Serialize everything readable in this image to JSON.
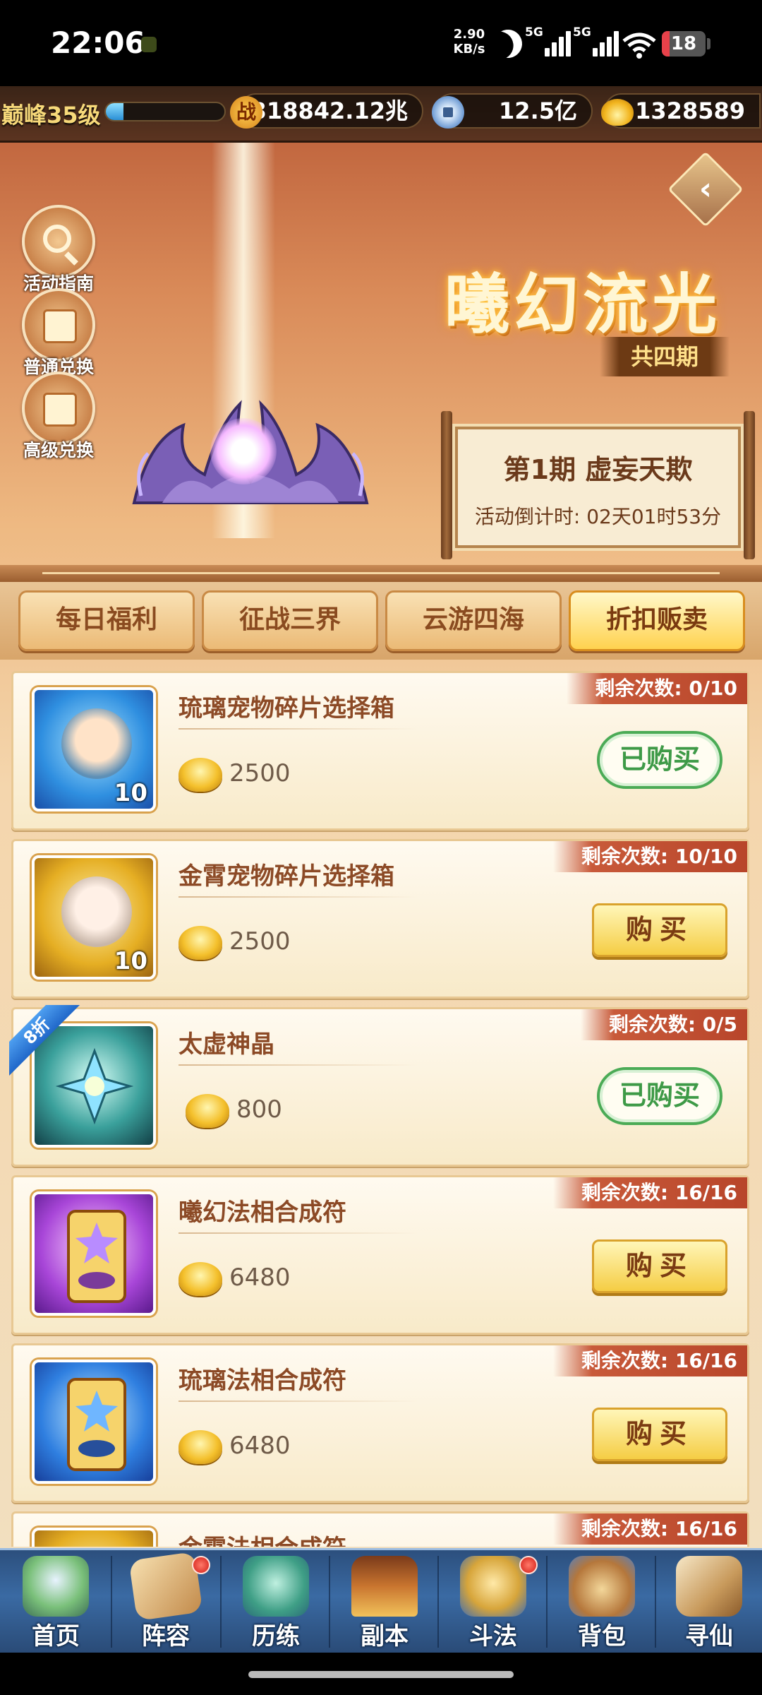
{
  "status": {
    "time": "22:06",
    "speed_value": "2.90",
    "speed_unit": "KB/s",
    "net1": "5G",
    "net2": "5G",
    "battery": "18",
    "battery_level": 0.18
  },
  "hud": {
    "level": "巅峰35级",
    "level_progress": 0.15,
    "power_icon": "战",
    "power": "318842.12兆",
    "coins": "12.5亿",
    "ingots": "1328589"
  },
  "side_buttons": [
    {
      "label": "活动指南",
      "icon": "magnifier-icon"
    },
    {
      "label": "普通兑换",
      "icon": "box-icon"
    },
    {
      "label": "高级兑换",
      "icon": "gift-icon"
    }
  ],
  "event": {
    "title": "曦幻流光",
    "periods": "共四期",
    "phase": "第1期  虚妄天欺",
    "countdown": "活动倒计时: 02天01时53分"
  },
  "tabs": [
    {
      "label": "每日福利",
      "active": false
    },
    {
      "label": "征战三界",
      "active": false
    },
    {
      "label": "云游四海",
      "active": false
    },
    {
      "label": "折扣贩卖",
      "active": true
    }
  ],
  "items": [
    {
      "name": "琉璃宠物碎片选择箱",
      "price": "2500",
      "remain": "剩余次数: 0/10",
      "button": "已购买",
      "bought": true,
      "count": "10",
      "discount": ""
    },
    {
      "name": "金霄宠物碎片选择箱",
      "price": "2500",
      "remain": "剩余次数: 10/10",
      "button": "购买",
      "bought": false,
      "count": "10",
      "discount": ""
    },
    {
      "name": "太虚神晶",
      "price": "800",
      "remain": "剩余次数: 0/5",
      "button": "已购买",
      "bought": true,
      "count": "",
      "discount": "8折"
    },
    {
      "name": "曦幻法相合成符",
      "price": "6480",
      "remain": "剩余次数: 16/16",
      "button": "购买",
      "bought": false,
      "count": "",
      "discount": ""
    },
    {
      "name": "琉璃法相合成符",
      "price": "6480",
      "remain": "剩余次数: 16/16",
      "button": "购买",
      "bought": false,
      "count": "",
      "discount": ""
    },
    {
      "name": "金霄法相合成符",
      "price": "",
      "remain": "剩余次数: 16/16",
      "button": "",
      "bought": false,
      "count": "",
      "discount": ""
    }
  ],
  "nav": [
    {
      "label": "首页",
      "icon": "home-mountain-icon",
      "badge": false
    },
    {
      "label": "阵容",
      "icon": "lineup-cards-icon",
      "badge": true
    },
    {
      "label": "历练",
      "icon": "training-turtle-icon",
      "badge": false
    },
    {
      "label": "副本",
      "icon": "dungeon-gate-icon",
      "badge": false
    },
    {
      "label": "斗法",
      "icon": "battle-crest-icon",
      "badge": true
    },
    {
      "label": "背包",
      "icon": "bag-icon",
      "badge": false
    },
    {
      "label": "寻仙",
      "icon": "scroll-search-icon",
      "badge": false
    }
  ]
}
